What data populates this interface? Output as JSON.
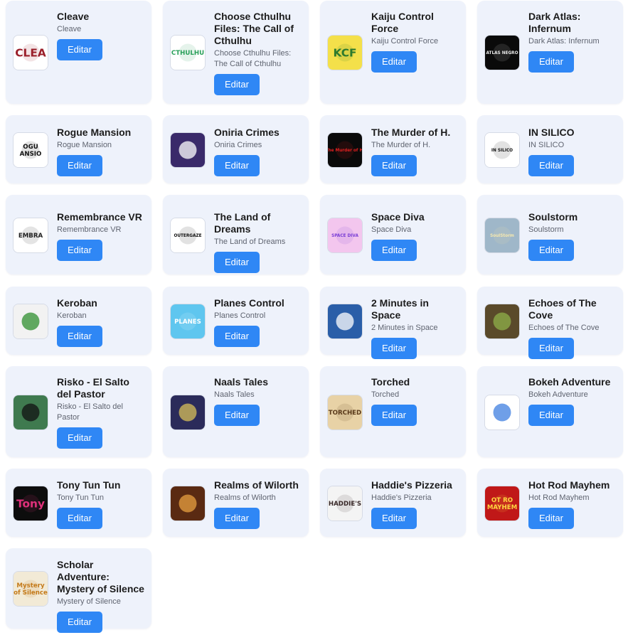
{
  "games": [
    {
      "title": "Cleave",
      "subtitle": "Cleave",
      "button": "Editar",
      "thumb_text": "CLEA",
      "thumb_bg": "#ffffff",
      "thumb_fg": "#9a1f2a"
    },
    {
      "title": "Choose Cthulhu Files: The Call of Cthulhu",
      "subtitle": "Choose Cthulhu Files: The Call of Cthulhu",
      "button": "Editar",
      "thumb_text": "CTHULHU",
      "thumb_bg": "#ffffff",
      "thumb_fg": "#2aa05a"
    },
    {
      "title": "Kaiju Control Force",
      "subtitle": "Kaiju Control Force",
      "button": "Editar",
      "thumb_text": "KCF",
      "thumb_bg": "#f4e04a",
      "thumb_fg": "#2d7a2d"
    },
    {
      "title": "Dark Atlas: Infernum",
      "subtitle": "Dark Atlas: Infernum",
      "button": "Editar",
      "thumb_text": "ATLAS NEGRO",
      "thumb_bg": "#0a0a0a",
      "thumb_fg": "#e8e8e8"
    },
    {
      "title": "Rogue Mansion",
      "subtitle": "Rogue Mansion",
      "button": "Editar",
      "thumb_text": "OGU\nANSIO",
      "thumb_bg": "#ffffff",
      "thumb_fg": "#111111"
    },
    {
      "title": "Oniria Crimes",
      "subtitle": "Oniria Crimes",
      "button": "Editar",
      "thumb_text": "",
      "thumb_bg": "#3a2a6a",
      "thumb_fg": "#ffffff"
    },
    {
      "title": "The Murder of H.",
      "subtitle": "The Murder of H.",
      "button": "Editar",
      "thumb_text": "The Murder of H.",
      "thumb_bg": "#0a0a0a",
      "thumb_fg": "#e02020"
    },
    {
      "title": "IN SILICO",
      "subtitle": "IN SILICO",
      "button": "Editar",
      "thumb_text": "IN SILICO",
      "thumb_bg": "#ffffff",
      "thumb_fg": "#111111"
    },
    {
      "title": "Remembrance VR",
      "subtitle": "Remembrance VR",
      "button": "Editar",
      "thumb_text": "EMBRA",
      "thumb_bg": "#ffffff",
      "thumb_fg": "#222222"
    },
    {
      "title": "The Land of Dreams",
      "subtitle": "The Land of Dreams",
      "button": "Editar",
      "thumb_text": "OUTERGAZE",
      "thumb_bg": "#ffffff",
      "thumb_fg": "#111111"
    },
    {
      "title": "Space Diva",
      "subtitle": "Space Diva",
      "button": "Editar",
      "thumb_text": "SPACE DIVA",
      "thumb_bg": "#f3c6ee",
      "thumb_fg": "#7b3fd6"
    },
    {
      "title": "Soulstorm",
      "subtitle": "Soulstorm",
      "button": "Editar",
      "thumb_text": "SoulStorm",
      "thumb_bg": "#9fb7c9",
      "thumb_fg": "#f5e8b0"
    },
    {
      "title": "Keroban",
      "subtitle": "Keroban",
      "button": "Editar",
      "thumb_text": "",
      "thumb_bg": "#f2f2f2",
      "thumb_fg": "#2f8f2f"
    },
    {
      "title": "Planes Control",
      "subtitle": "Planes Control",
      "button": "Editar",
      "thumb_text": "PLANES",
      "thumb_bg": "#5fc6ef",
      "thumb_fg": "#ffffff"
    },
    {
      "title": "2 Minutes in Space",
      "subtitle": "2 Minutes in Space",
      "button": "Editar",
      "thumb_text": "",
      "thumb_bg": "#2a5ea8",
      "thumb_fg": "#ffffff"
    },
    {
      "title": "Echoes of The Cove",
      "subtitle": "Echoes of The Cove",
      "button": "Editar",
      "thumb_text": "",
      "thumb_bg": "#5a4a2a",
      "thumb_fg": "#8fb04a"
    },
    {
      "title": "Risko - El Salto del Pastor",
      "subtitle": "Risko - El Salto del Pastor",
      "button": "Editar",
      "thumb_text": "",
      "thumb_bg": "#3f7a4f",
      "thumb_fg": "#111111"
    },
    {
      "title": "Naals Tales",
      "subtitle": "Naals Tales",
      "button": "Editar",
      "thumb_text": "",
      "thumb_bg": "#2b2b5a",
      "thumb_fg": "#d8c05a"
    },
    {
      "title": "Torched",
      "subtitle": "Torched",
      "button": "Editar",
      "thumb_text": "TORCHED",
      "thumb_bg": "#e8d2a6",
      "thumb_fg": "#5a3a1a"
    },
    {
      "title": "Bokeh Adventure",
      "subtitle": "Bokeh Adventure",
      "button": "Editar",
      "thumb_text": "",
      "thumb_bg": "#ffffff",
      "thumb_fg": "#3f7fe0"
    },
    {
      "title": "Tony Tun Tun",
      "subtitle": "Tony Tun Tun",
      "button": "Editar",
      "thumb_text": "Tony",
      "thumb_bg": "#0d0d0d",
      "thumb_fg": "#e0307a"
    },
    {
      "title": "Realms of Wilorth",
      "subtitle": "Realms of Wilorth",
      "button": "Editar",
      "thumb_text": "",
      "thumb_bg": "#5a2a12",
      "thumb_fg": "#e8a040"
    },
    {
      "title": "Haddie's Pizzeria",
      "subtitle": "Haddie's Pizzeria",
      "button": "Editar",
      "thumb_text": "HADDIE'S",
      "thumb_bg": "#f4f4f4",
      "thumb_fg": "#3a2a2a"
    },
    {
      "title": "Hot Rod Mayhem",
      "subtitle": "Hot Rod Mayhem",
      "button": "Editar",
      "thumb_text": "OT RO\nMAYHEM",
      "thumb_bg": "#c01818",
      "thumb_fg": "#ffd640"
    },
    {
      "title": "Scholar Adventure: Mystery of Silence",
      "subtitle": "Mystery of Silence",
      "button": "Editar",
      "thumb_text": "Mystery\nof Silence",
      "thumb_bg": "#f2ead6",
      "thumb_fg": "#c47a1a"
    }
  ]
}
